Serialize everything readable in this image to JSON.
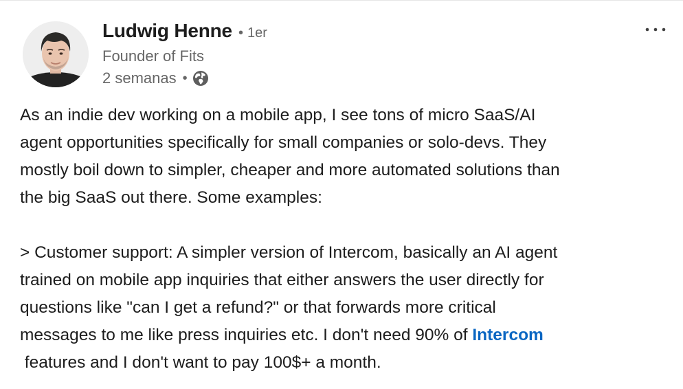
{
  "author": {
    "name": "Ludwig Henne",
    "separator": "•",
    "degree": "1er",
    "headline": "Founder of Fits",
    "time": "2 semanas",
    "meta_separator": "•",
    "visibility_icon": "globe-icon"
  },
  "actions": {
    "more_icon": "more-horizontal-icon"
  },
  "post": {
    "lines": [
      "As an indie dev working on a mobile app, I see tons of micro SaaS/AI",
      "agent opportunities specifically for small companies or solo-devs. They",
      "mostly boil down to simpler, cheaper and more automated solutions than",
      "the big SaaS out there. Some examples:"
    ],
    "lines2": [
      "> Customer support: A simpler version of Intercom, basically an AI agent",
      "trained on mobile app inquiries that either answers the user directly for",
      "questions like \"can I get a refund?\" or that forwards more critical"
    ],
    "line_before_mention": "messages to me like press inquiries etc. I don't need 90% of ",
    "mention": "Intercom",
    "line_after_mention": " features and I don't want to pay 100$+ a month."
  },
  "colors": {
    "text": "#1d1d1d",
    "secondary": "#666666",
    "link": "#0a66c2"
  }
}
